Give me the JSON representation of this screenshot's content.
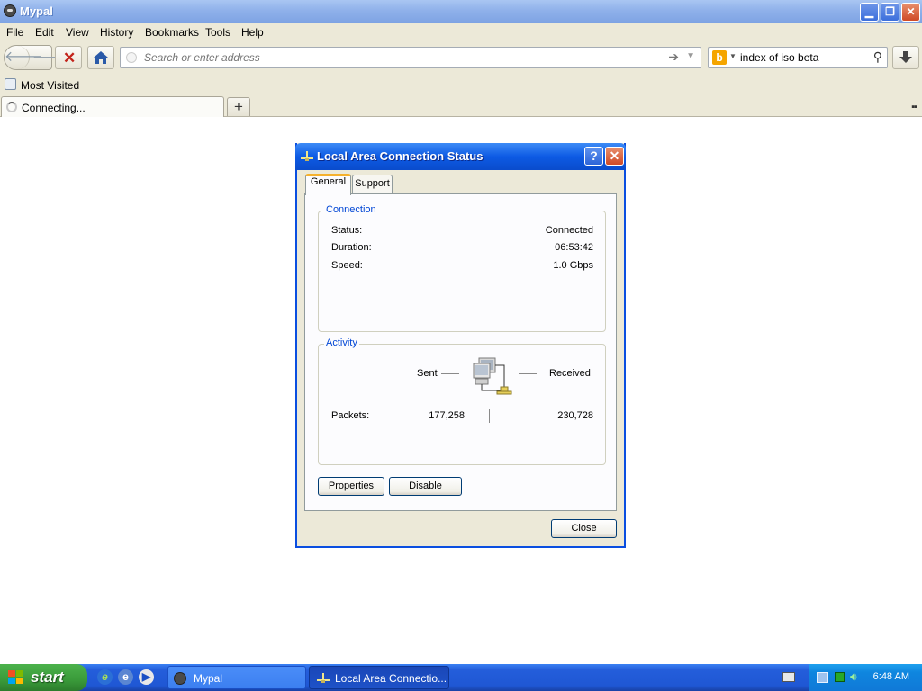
{
  "browser": {
    "title": "Mypal",
    "menu": [
      "File",
      "Edit",
      "View",
      "History",
      "Bookmarks",
      "Tools",
      "Help"
    ],
    "url_placeholder": "Search or enter address",
    "search_value": "index of iso beta",
    "bookmarks": [
      "Most Visited"
    ],
    "tabs": [
      {
        "label": "Connecting..."
      }
    ]
  },
  "dialog": {
    "title": "Local Area Connection Status",
    "help_label": "?",
    "tabs": [
      "General",
      "Support"
    ],
    "connection": {
      "legend": "Connection",
      "rows": [
        {
          "label": "Status:",
          "value": "Connected"
        },
        {
          "label": "Duration:",
          "value": "06:53:42"
        },
        {
          "label": "Speed:",
          "value": "1.0 Gbps"
        }
      ]
    },
    "activity": {
      "legend": "Activity",
      "sent_label": "Sent",
      "received_label": "Received",
      "packets_label": "Packets:",
      "packets_sent": "177,258",
      "packets_received": "230,728"
    },
    "buttons": {
      "properties": "Properties",
      "disable": "Disable",
      "close": "Close"
    }
  },
  "taskbar": {
    "start_label": "start",
    "items": [
      {
        "label": "Mypal",
        "active": false
      },
      {
        "label": "Local Area Connectio...",
        "active": true
      }
    ],
    "clock": "6:48 AM"
  },
  "colors": {
    "xp_blue": "#0a4ee0",
    "dialog_face": "#ece9d8",
    "group_legend": "#0046d5",
    "start_green": "#3a9a3a"
  }
}
